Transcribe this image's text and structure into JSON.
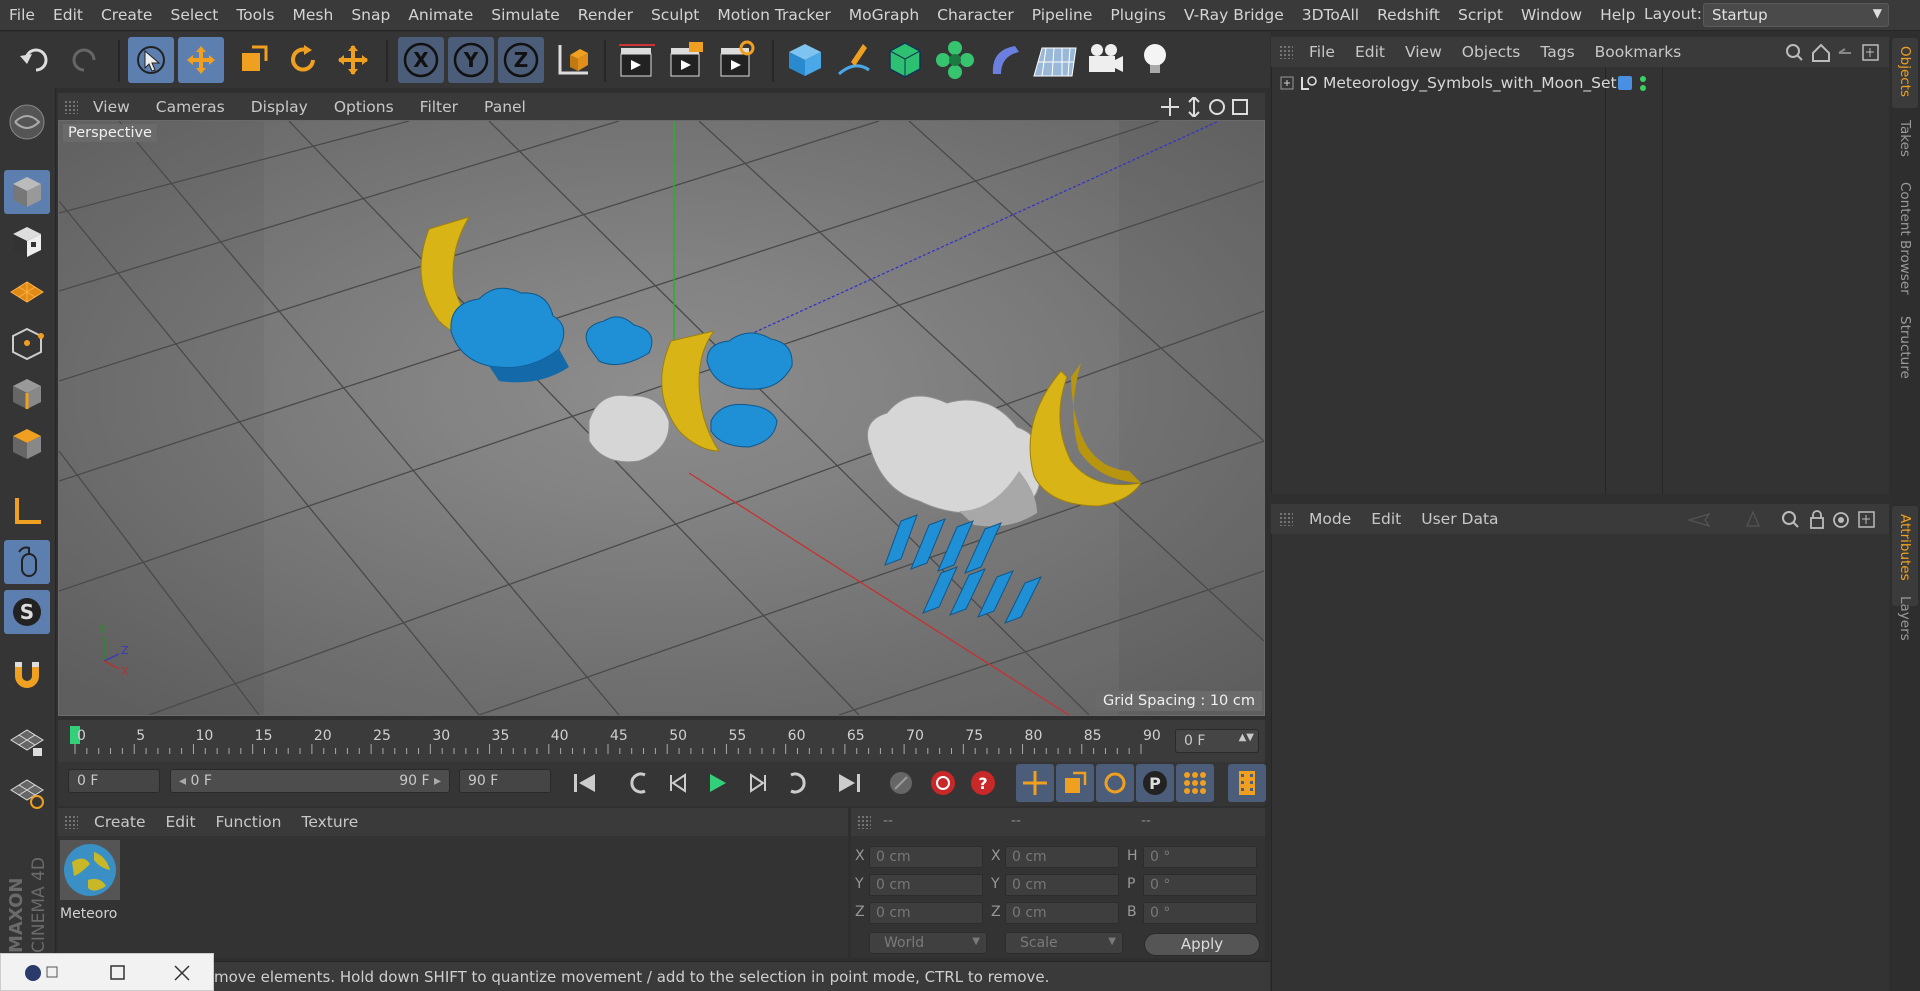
{
  "menu": [
    "File",
    "Edit",
    "Create",
    "Select",
    "Tools",
    "Mesh",
    "Snap",
    "Animate",
    "Simulate",
    "Render",
    "Sculpt",
    "Motion Tracker",
    "MoGraph",
    "Character",
    "Pipeline",
    "Plugins",
    "V-Ray Bridge",
    "3DToAll",
    "Redshift",
    "Script",
    "Window",
    "Help"
  ],
  "layout": {
    "label": "Layout:",
    "value": "Startup"
  },
  "axis_buttons": {
    "x": "X",
    "y": "Y",
    "z": "Z"
  },
  "viewport": {
    "menu": [
      "View",
      "Cameras",
      "Display",
      "Options",
      "Filter",
      "Panel"
    ],
    "camera_label": "Perspective",
    "grid_spacing": "Grid Spacing : 10 cm",
    "axis_gizmo": {
      "y": "Y",
      "z": "Z",
      "x": "X"
    }
  },
  "timeline": {
    "ticks": [
      "0",
      "5",
      "10",
      "15",
      "20",
      "25",
      "30",
      "35",
      "40",
      "45",
      "50",
      "55",
      "60",
      "65",
      "70",
      "75",
      "80",
      "85",
      "90"
    ],
    "current_frame": "0 F"
  },
  "transport": {
    "start_field": "0 F",
    "range_start": "0 F",
    "range_end": "90 F",
    "end_field": "90 F"
  },
  "material_manager": {
    "menu": [
      "Create",
      "Edit",
      "Function",
      "Texture"
    ],
    "material_name": "Meteoro"
  },
  "coordinates": {
    "headers": [
      "--",
      "--",
      "--"
    ],
    "rows": [
      {
        "l1": "X",
        "v1": "0 cm",
        "l2": "X",
        "v2": "0 cm",
        "l3": "H",
        "v3": "0 °"
      },
      {
        "l1": "Y",
        "v1": "0 cm",
        "l2": "Y",
        "v2": "0 cm",
        "l3": "P",
        "v3": "0 °"
      },
      {
        "l1": "Z",
        "v1": "0 cm",
        "l2": "Z",
        "v2": "0 cm",
        "l3": "B",
        "v3": "0 °"
      }
    ],
    "mode_world": "World",
    "mode_scale": "Scale",
    "apply": "Apply"
  },
  "status": "move elements. Hold down SHIFT to quantize movement / add to the selection in point mode, CTRL to remove.",
  "brand": {
    "maxon": "MAXON",
    "product": "CINEMA 4D"
  },
  "object_manager": {
    "menu": [
      "File",
      "Edit",
      "View",
      "Objects",
      "Tags",
      "Bookmarks"
    ],
    "object_name": "Meteorology_Symbols_with_Moon_Set",
    "layer_color": "#4a90e2"
  },
  "attributes": {
    "menu": [
      "Mode",
      "Edit",
      "User Data"
    ]
  },
  "right_tabs": [
    "Objects",
    "Takes",
    "Content Browser",
    "Structure",
    "Attributes",
    "Layers"
  ],
  "colors": {
    "accent": "#f0a020",
    "active_tool": "#5c7fb0",
    "moon": "#d9b417",
    "cloud_blue": "#1f8fd6",
    "cloud_white": "#d8d8d8"
  }
}
